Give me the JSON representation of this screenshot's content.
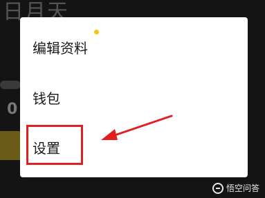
{
  "background": {
    "title": "日月天"
  },
  "menu": {
    "items": [
      {
        "label": "编辑资料"
      },
      {
        "label": "钱包"
      },
      {
        "label": "设置"
      }
    ]
  },
  "colors": {
    "highlight": "#e02020",
    "notify_dot": "#f5c518"
  },
  "watermark": {
    "text": "悟空问答"
  }
}
